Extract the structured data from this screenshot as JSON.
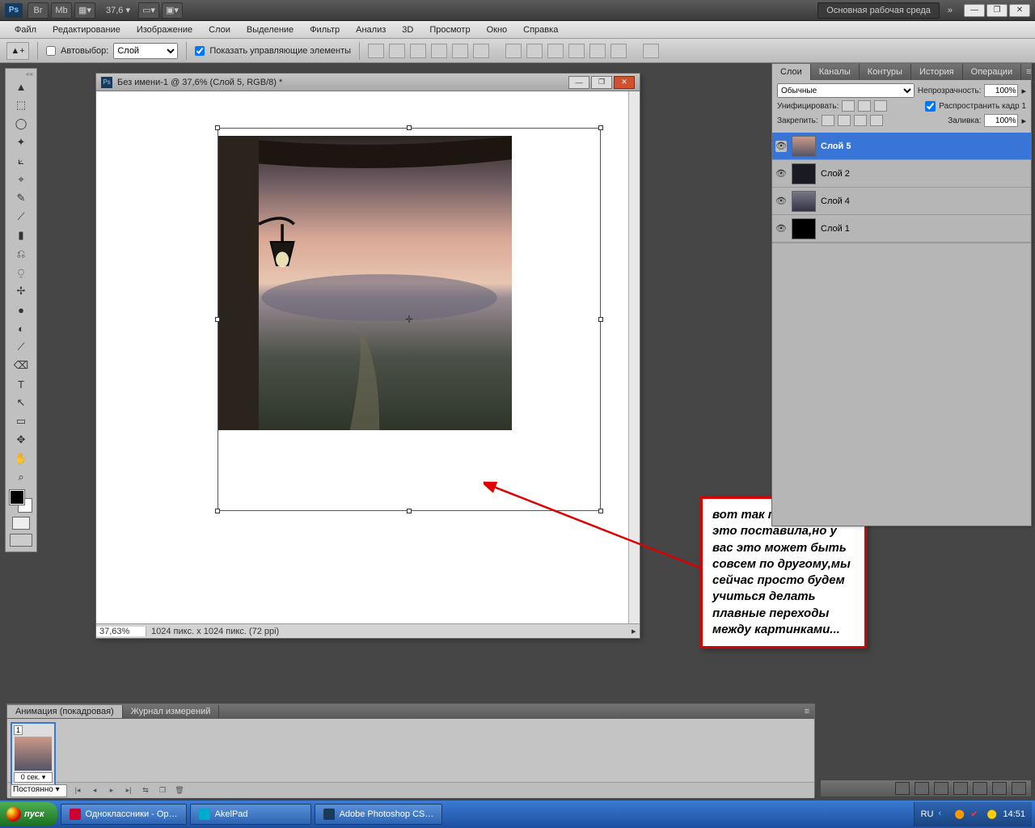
{
  "appbar": {
    "logo": "Ps",
    "zoom": "37,6 ▾",
    "workspace": "Основная рабочая среда",
    "chev": "»",
    "win": [
      "—",
      "❐",
      "✕"
    ]
  },
  "menu": [
    "Файл",
    "Редактирование",
    "Изображение",
    "Слои",
    "Выделение",
    "Фильтр",
    "Анализ",
    "3D",
    "Просмотр",
    "Окно",
    "Справка"
  ],
  "optbar": {
    "auto_label": "Автовыбор:",
    "auto_select": "Слой",
    "show_label": "Показать управляющие элементы"
  },
  "doc": {
    "title": "Без имени-1 @ 37,6% (Слой 5, RGB/8) *",
    "zoom": "37,63%",
    "info": "1024 пикс. x 1024 пикс. (72 ppi)"
  },
  "annot": "вот так примерно я это поставила,но у вас это может быть совсем по другому,мы сейчас просто будем учиться делать плавные переходы между картинками...",
  "layers": {
    "tabs": [
      "Слои",
      "Каналы",
      "Контуры",
      "История",
      "Операции"
    ],
    "blend": "Обычные",
    "op_label": "Непрозрачность:",
    "op_val": "100%",
    "unify": "Унифицировать:",
    "spread": "Распространить кадр 1",
    "lock": "Закрепить:",
    "fill_label": "Заливка:",
    "fill_val": "100%",
    "items": [
      {
        "name": "Слой 5"
      },
      {
        "name": "Слой 2"
      },
      {
        "name": "Слой 4"
      },
      {
        "name": "Слой 1"
      }
    ]
  },
  "anim": {
    "tabs": [
      "Анимация (покадровая)",
      "Журнал измерений"
    ],
    "frame_num": "1",
    "frame_time": "0 сек. ▾",
    "loop": "Постоянно ▾"
  },
  "tools": [
    "▲",
    "⬚",
    "◯",
    "✦",
    "⟀",
    "⌖",
    "✎",
    "⟋",
    "▮",
    "⎌",
    "⍜",
    "✢",
    "●",
    "◐",
    "⟋",
    "◔",
    "⌫",
    "T",
    "↖",
    "▭",
    "✥",
    "⌕",
    "✋",
    "◒"
  ],
  "taskbar": {
    "start": "пуск",
    "items": [
      {
        "ico": "o",
        "label": "Одноклассники - Op…"
      },
      {
        "ico": "a",
        "label": "AkelPad"
      },
      {
        "ico": "p",
        "label": "Adobe Photoshop CS…"
      }
    ],
    "lang": "RU",
    "time": "14:51"
  }
}
